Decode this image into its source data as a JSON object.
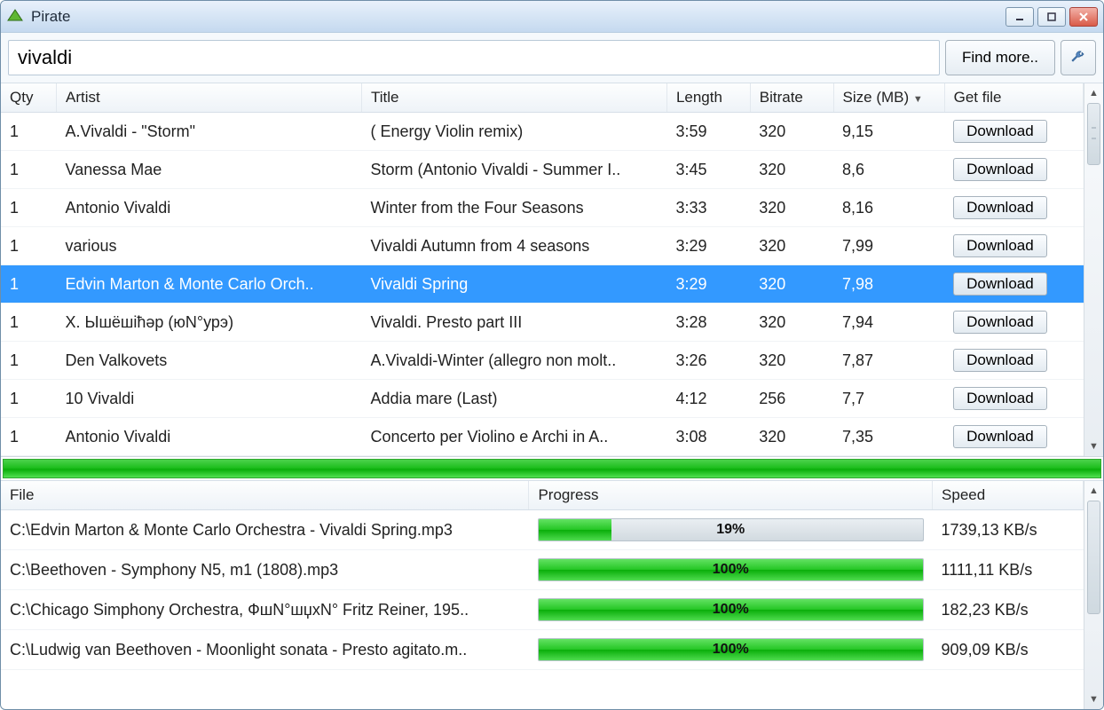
{
  "app": {
    "title": "Pirate"
  },
  "search": {
    "value": "vivaldi",
    "find_more": "Find more.."
  },
  "results": {
    "headers": {
      "qty": "Qty",
      "artist": "Artist",
      "title": "Title",
      "length": "Length",
      "bitrate": "Bitrate",
      "size": "Size (MB)",
      "get": "Get file"
    },
    "download_label": "Download",
    "selected_index": 4,
    "rows": [
      {
        "qty": "1",
        "artist": "A.Vivaldi - \"Storm\"",
        "title": "( Energy Violin remix)",
        "length": "3:59",
        "bitrate": "320",
        "size": "9,15"
      },
      {
        "qty": "1",
        "artist": "Vanessa Mae",
        "title": "Storm (Antonio Vivaldi - Summer I..",
        "length": "3:45",
        "bitrate": "320",
        "size": "8,6"
      },
      {
        "qty": "1",
        "artist": "Antonio Vivaldi",
        "title": "Winter from the Four Seasons",
        "length": "3:33",
        "bitrate": "320",
        "size": "8,16"
      },
      {
        "qty": "1",
        "artist": "various",
        "title": "Vivaldi Autumn from 4 seasons",
        "length": "3:29",
        "bitrate": "320",
        "size": "7,99"
      },
      {
        "qty": "1",
        "artist": "Edvin Marton & Monte Carlo Orch..",
        "title": "Vivaldi Spring",
        "length": "3:29",
        "bitrate": "320",
        "size": "7,98"
      },
      {
        "qty": "1",
        "artist": "Х. Ышёшіћәр (юN°урэ)",
        "title": "Vivaldi. Presto part III",
        "length": "3:28",
        "bitrate": "320",
        "size": "7,94"
      },
      {
        "qty": "1",
        "artist": "Den Valkovets",
        "title": "A.Vivaldi-Winter (allegro non molt..",
        "length": "3:26",
        "bitrate": "320",
        "size": "7,87"
      },
      {
        "qty": "1",
        "artist": "10 Vivaldi",
        "title": "Addia mare (Last)",
        "length": "4:12",
        "bitrate": "256",
        "size": "7,7"
      },
      {
        "qty": "1",
        "artist": "Antonio Vivaldi",
        "title": "Concerto per Violino e Archi in A..",
        "length": "3:08",
        "bitrate": "320",
        "size": "7,35"
      }
    ]
  },
  "downloads": {
    "headers": {
      "file": "File",
      "progress": "Progress",
      "speed": "Speed"
    },
    "rows": [
      {
        "file": "C:\\Edvin Marton & Monte Carlo Orchestra - Vivaldi Spring.mp3",
        "pct": 19,
        "pct_label": "19%",
        "speed": "1739,13 KB/s"
      },
      {
        "file": "C:\\Beethoven - Symphony N5, m1 (1808).mp3",
        "pct": 100,
        "pct_label": "100%",
        "speed": "1111,11 KB/s"
      },
      {
        "file": "C:\\Chicago Simphony Orchestra, ФшN°шџхN° Fritz Reiner, 195..",
        "pct": 100,
        "pct_label": "100%",
        "speed": "182,23 KB/s"
      },
      {
        "file": "C:\\Ludwig van Beethoven - Moonlight sonata - Presto agitato.m..",
        "pct": 100,
        "pct_label": "100%",
        "speed": "909,09 KB/s"
      }
    ]
  }
}
